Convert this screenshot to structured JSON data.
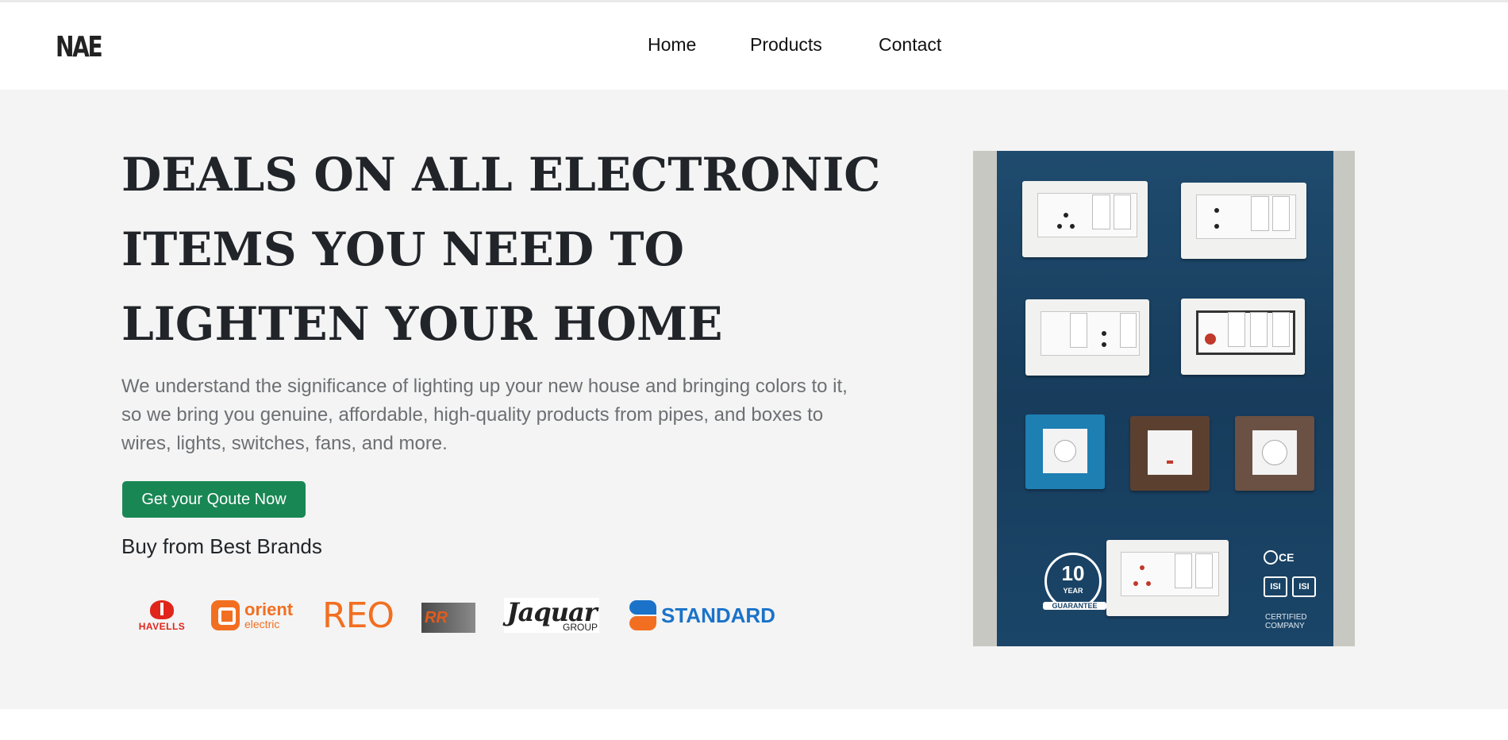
{
  "brand": {
    "logo_text": "NAE"
  },
  "nav": {
    "home": "Home",
    "products": "Products",
    "contact": "Contact"
  },
  "hero": {
    "headline": "DEALS ON ALL ELECTRONIC ITEMS YOU NEED TO LIGHTEN YOUR HOME",
    "lead": "We understand the significance of lighting up your new house and bringing colors to it, so we bring you genuine, affordable, high-quality products from pipes, and boxes to wires, lights, switches, fans, and more.",
    "cta_label": "Get your Qoute Now",
    "brands_title": "Buy from Best Brands"
  },
  "brands": {
    "havells": "HAVELLS",
    "orient_1": "orient",
    "orient_2": "electric",
    "reo": "REO",
    "rr": "RR",
    "jaguar_1": "Jaquar",
    "jaguar_2": "GROUP",
    "standard": "STANDARD"
  },
  "product_image": {
    "guarantee_number": "10",
    "guarantee_year": "YEAR",
    "guarantee_label": "GUARANTEE",
    "ce_mark": "CE",
    "isi_1": "ISI",
    "isi_2": "ISI",
    "certified": "CERTIFIED COMPANY"
  },
  "colors": {
    "cta_bg": "#198754",
    "hero_bg": "#f4f4f4",
    "heading": "#212529",
    "lead_text": "#6c6f73"
  }
}
